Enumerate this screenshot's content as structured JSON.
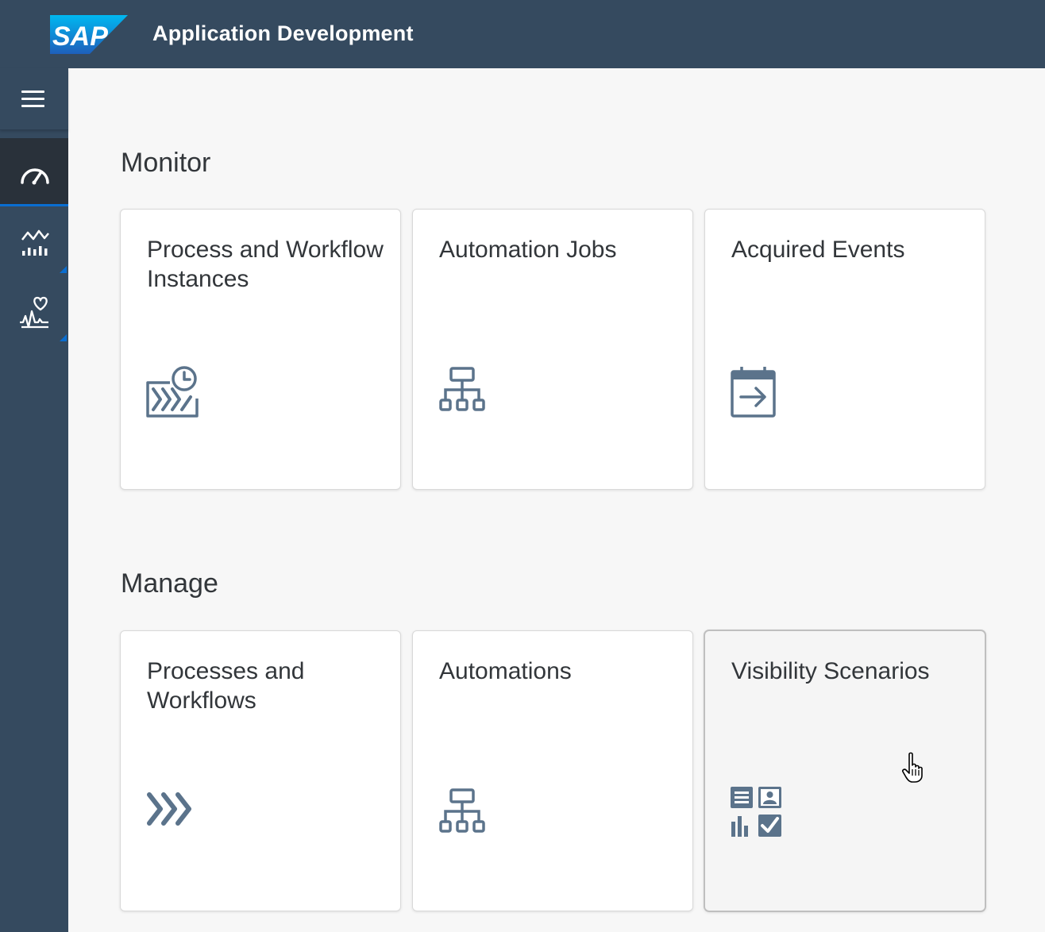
{
  "shellbar": {
    "logo_text": "SAP",
    "title": "Application Development"
  },
  "sidenav": {
    "items": [
      {
        "icon": "menu-icon"
      },
      {
        "icon": "dashboard-gauge-icon",
        "selected": true
      },
      {
        "icon": "performance-chart-icon",
        "has_children": true
      },
      {
        "icon": "health-monitor-icon",
        "has_children": true
      }
    ]
  },
  "sections": [
    {
      "title": "Monitor",
      "tiles": [
        {
          "title": "Process and Workflow Instances",
          "icon": "process-instances-icon"
        },
        {
          "title": "Automation Jobs",
          "icon": "hierarchy-icon"
        },
        {
          "title": "Acquired Events",
          "icon": "calendar-arrow-icon"
        }
      ]
    },
    {
      "title": "Manage",
      "tiles": [
        {
          "title": "Processes and Workflows",
          "icon": "process-chevrons-icon"
        },
        {
          "title": "Automations",
          "icon": "hierarchy-icon"
        },
        {
          "title": "Visibility Scenarios",
          "icon": "visibility-scenarios-icon",
          "hovered": true
        }
      ]
    }
  ],
  "colors": {
    "shell": "#354a5f",
    "accent": "#0a6ed1",
    "icon": "#5b738b",
    "text": "#32363a"
  }
}
